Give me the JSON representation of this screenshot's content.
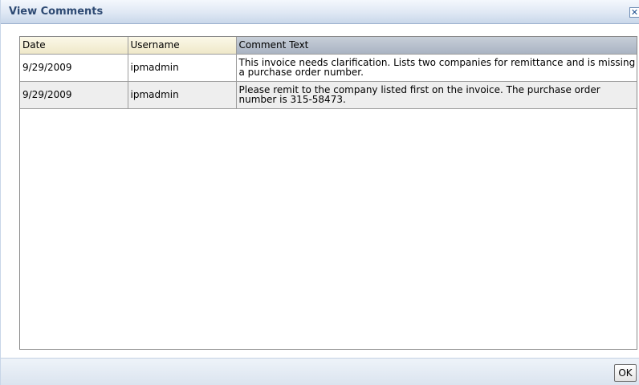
{
  "dialog": {
    "title": "View Comments",
    "close_icon": "close-x-icon",
    "ok_label": "OK"
  },
  "table": {
    "columns": [
      "Date",
      "Username",
      "Comment Text"
    ],
    "rows": [
      {
        "date": "9/29/2009",
        "username": "ipmadmin",
        "comment_line1": "This invoice needs clarification. Lists two companies for remittance and is missing",
        "comment_line2": "a purchase order number."
      },
      {
        "date": "9/29/2009",
        "username": "ipmadmin",
        "comment_line1": "Please remit to the company listed first on the invoice. The purchase order",
        "comment_line2": "number is 315-58473."
      }
    ]
  },
  "colors": {
    "title_text": "#2e4a73",
    "header_selected": "#a9b3c2",
    "alt_row": "#eeeeee"
  }
}
